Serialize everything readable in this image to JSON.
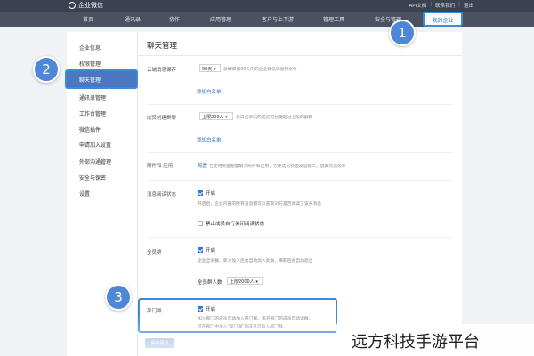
{
  "app": {
    "title": "企业微信",
    "logo_icon": "wecom-logo-icon"
  },
  "top_links": [
    "API文档",
    "联系我们",
    "退出"
  ],
  "nav": {
    "items": [
      "首页",
      "通讯录",
      "协作",
      "应用管理",
      "客户与上下游",
      "管理工具",
      "安全与管理",
      "我的企业"
    ],
    "active": "我的企业"
  },
  "sidebar": {
    "items": [
      "企业信息",
      "权限管理",
      "聊天管理",
      "通讯录管理",
      "工作台管理",
      "微信插件",
      "申请加入设置",
      "外部沟通管理",
      "安全与保密",
      "设置"
    ],
    "active": "聊天管理"
  },
  "content": {
    "title": "聊天管理",
    "sections": {
      "limit": {
        "label": "云端消息保存",
        "select_value": "90天",
        "desc": "云端保留90天内的企业微信消息和文件",
        "add_link": "添加白名单"
      },
      "group": {
        "label": "成员创建群聊",
        "select_value": "上限200人",
        "desc": "仅白名单内的成员可创建超过上限的群聊",
        "add_link": "添加白名单"
      },
      "attachment": {
        "label": "附件和 应用",
        "link": "配置",
        "desc": "在使用页面配置聊天附件和应用，方便成员快速发送聊天，提高沟通效率"
      },
      "read": {
        "label": "消息阅读状态",
        "checkbox_label": "开启",
        "desc": "开启后，企业内部的所有消息都可以获取对方是否阅读了该条消息",
        "checkbox2_label": "禁止成员自行关闭阅读状态"
      },
      "allgroup": {
        "label": "全员群",
        "checkbox_label": "开启",
        "desc": "企业全员群，新人加入后会自动加入此群，离职后会自动退出",
        "count_label": "全员群人数",
        "count_value": "上限2000人"
      },
      "dept": {
        "label": "部门群",
        "checkbox_label": "开启",
        "desc1": "加入部门的成员自动加入部门群，离开部门的成员自动退群。",
        "desc2": "可在部门中加入\"部门群\"后成员可加入部门群。"
      }
    },
    "save_label": "保存更改"
  },
  "callouts": [
    "1",
    "2",
    "3"
  ],
  "watermark": "远方科技手游平台",
  "colors": {
    "accent": "#3b8bd9",
    "badge": "#4e86d8",
    "topbar": "#3a4250",
    "navbar": "#4a5261",
    "sidebar_active": "#4a77c0"
  }
}
